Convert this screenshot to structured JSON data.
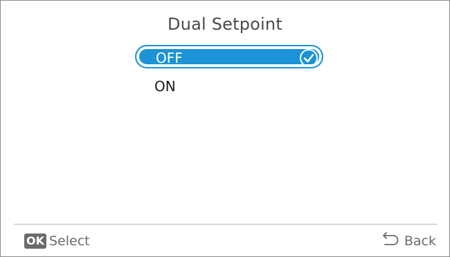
{
  "screen": {
    "title": "Dual Setpoint"
  },
  "options": [
    {
      "label": "OFF",
      "selected": true
    },
    {
      "label": "ON",
      "selected": false
    }
  ],
  "footer": {
    "ok_badge": "OK",
    "select_label": "Select",
    "back_label": "Back"
  },
  "colors": {
    "accent": "#1b93d6",
    "text_dark": "#1a1a1a",
    "text_grey": "#6a6a6a",
    "badge_bg": "#6b6b6b"
  },
  "icons": {
    "selected_marker": "check-circle-icon",
    "back": "back-arrow-icon"
  }
}
